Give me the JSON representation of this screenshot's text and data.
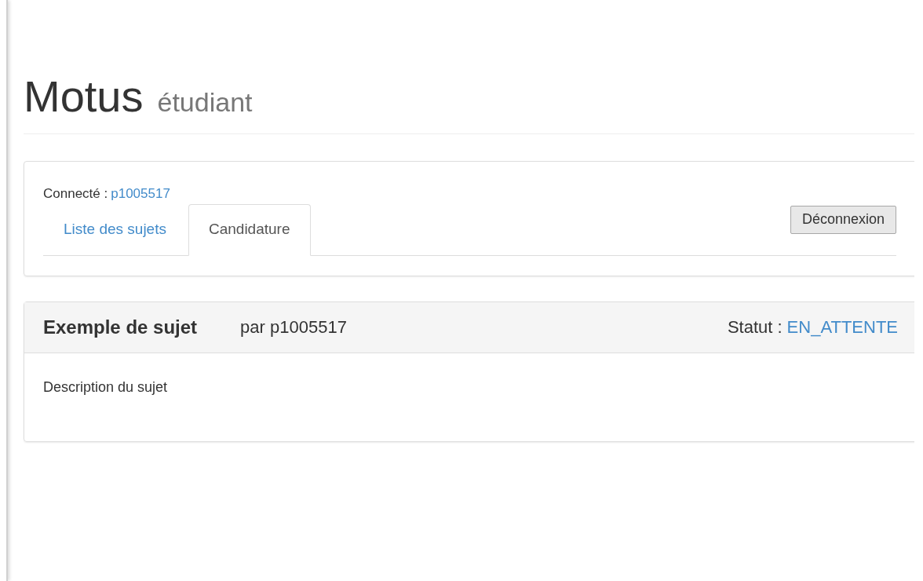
{
  "header": {
    "title": "Motus",
    "subtitle": "étudiant"
  },
  "session": {
    "label": "Connecté :",
    "user": "p1005517"
  },
  "tabs": [
    {
      "label": "Liste des sujets",
      "selected": false
    },
    {
      "label": "Candidature",
      "selected": true
    }
  ],
  "logout_button": "Déconnexion",
  "subject": {
    "title": "Exemple de sujet",
    "author": "par p1005517",
    "status_label": "Statut :",
    "status": "EN_ATTENTE",
    "description": "Description du sujet"
  }
}
